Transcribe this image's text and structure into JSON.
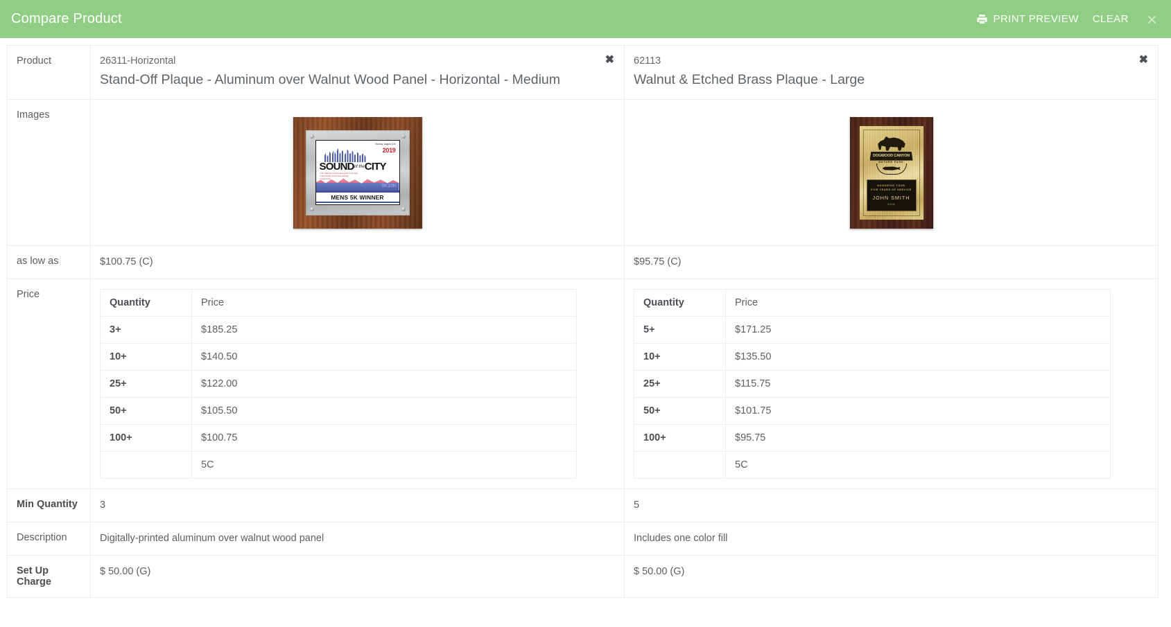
{
  "header": {
    "title": "Compare Product",
    "print_preview_label": "PRINT PREVIEW",
    "clear_label": "CLEAR",
    "close_icon": "close-icon",
    "printer_icon": "printer-icon",
    "background_color": "#90ce84",
    "text_color": "#ffffff"
  },
  "row_labels": {
    "product": "Product",
    "images": "Images",
    "as_low_as": "as low as",
    "price": "Price",
    "min_quantity": "Min Quantity",
    "description": "Description",
    "setup_charge": "Set Up Charge"
  },
  "price_table_headers": {
    "quantity": "Quantity",
    "price": "Price"
  },
  "remove_icon": "remove-product-icon",
  "products": [
    {
      "sku": "26311-Horizontal",
      "name": "Stand-Off Plaque - Aluminum over Walnut Wood Panel - Horizontal - Medium",
      "as_low_as": "$100.75 (C)",
      "min_quantity": "3",
      "description": "Digitally-printed aluminum over walnut wood panel",
      "setup_charge": "$ 50.00 (G)",
      "price_tiers": [
        {
          "quantity": "3+",
          "price": "$185.25"
        },
        {
          "quantity": "10+",
          "price": "$140.50"
        },
        {
          "quantity": "25+",
          "price": "$122.00"
        },
        {
          "quantity": "50+",
          "price": "$105.50"
        },
        {
          "quantity": "100+",
          "price": "$100.75"
        },
        {
          "quantity": "",
          "price": "5C"
        }
      ],
      "image": {
        "alt": "Stand-off aluminum plaque on walnut wood panel",
        "date_line": "Sunday, August 11th",
        "year": "2019",
        "title_main1": "SOUND",
        "title_of_the": "of the",
        "title_main2": "CITY",
        "tagline": "A 5K celebrating Citizen Recognition & the best in both locally-sourced and national programming",
        "race_label": "5K10K",
        "award_line": "MENS 5K WINNER"
      }
    },
    {
      "sku": "62113",
      "name": "Walnut & Etched Brass Plaque - Large",
      "as_low_as": "$95.75 (C)",
      "min_quantity": "5",
      "description": "Includes one color fill",
      "setup_charge": "$ 50.00 (G)",
      "price_tiers": [
        {
          "quantity": "5+",
          "price": "$171.25"
        },
        {
          "quantity": "10+",
          "price": "$135.50"
        },
        {
          "quantity": "25+",
          "price": "$115.75"
        },
        {
          "quantity": "50+",
          "price": "$101.75"
        },
        {
          "quantity": "100+",
          "price": "$95.75"
        },
        {
          "quantity": "",
          "price": "5C"
        }
      ],
      "image": {
        "alt": "Walnut plaque with etched brass plate",
        "logo_name": "DOGWOOD CANYON",
        "logo_sub": "NATURE PARK",
        "honor_line1": "HONORING YOUR",
        "honor_line2": "FIVE YEARS OF SERVICE",
        "recipient": "JOHN SMITH",
        "year": "2018"
      }
    }
  ]
}
